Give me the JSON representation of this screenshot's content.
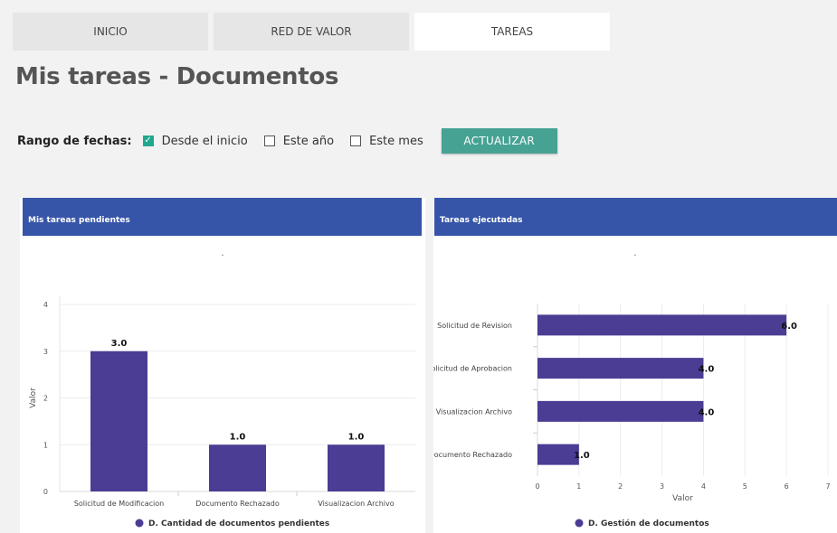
{
  "tabs": [
    {
      "label": "INICIO",
      "active": false
    },
    {
      "label": "RED DE VALOR",
      "active": false
    },
    {
      "label": "TAREAS",
      "active": true
    }
  ],
  "page_title": "Mis tareas - Documentos",
  "filters": {
    "label": "Rango de fechas:",
    "options": [
      {
        "label": "Desde el inicio",
        "checked": true
      },
      {
        "label": "Este año",
        "checked": false
      },
      {
        "label": "Este mes",
        "checked": false
      }
    ],
    "button_label": "ACTUALIZAR"
  },
  "colors": {
    "header": "#3655a8",
    "bar": "#4b3c94",
    "button": "#46a293",
    "checkbox": "#1fa88e"
  },
  "panels": {
    "left": {
      "title": "Mis tareas pendientes"
    },
    "right": {
      "title": "Tareas ejecutadas"
    }
  },
  "chart_data": [
    {
      "type": "bar",
      "orientation": "vertical",
      "title": ".",
      "categories": [
        "Solicitud de Modificacion",
        "Documento Rechazado",
        "Visualizacion Archivo"
      ],
      "series": [
        {
          "name": "D. Cantidad de documentos pendientes",
          "values": [
            3,
            1,
            1
          ]
        }
      ],
      "data_labels": [
        "3.0",
        "1.0",
        "1.0"
      ],
      "ylabel": "Valor",
      "ylim": [
        0,
        4
      ],
      "yticks": [
        "0",
        "1",
        "2",
        "3",
        "4"
      ],
      "grid": true,
      "legend": "bottom"
    },
    {
      "type": "bar",
      "orientation": "horizontal",
      "title": ".",
      "categories": [
        "Solicitud de Revision",
        "Solicitud de Aprobacion",
        "Visualizacion Archivo",
        "Documento Rechazado"
      ],
      "series": [
        {
          "name": "D. Gestión de documentos",
          "values": [
            6,
            4,
            4,
            1
          ]
        }
      ],
      "data_labels": [
        "6.0",
        "4.0",
        "4.0",
        "1.0"
      ],
      "xlabel": "Valor",
      "xlim": [
        0,
        7
      ],
      "xticks": [
        "0",
        "1",
        "2",
        "3",
        "4",
        "5",
        "6",
        "7"
      ],
      "grid": true,
      "legend": "bottom"
    }
  ]
}
